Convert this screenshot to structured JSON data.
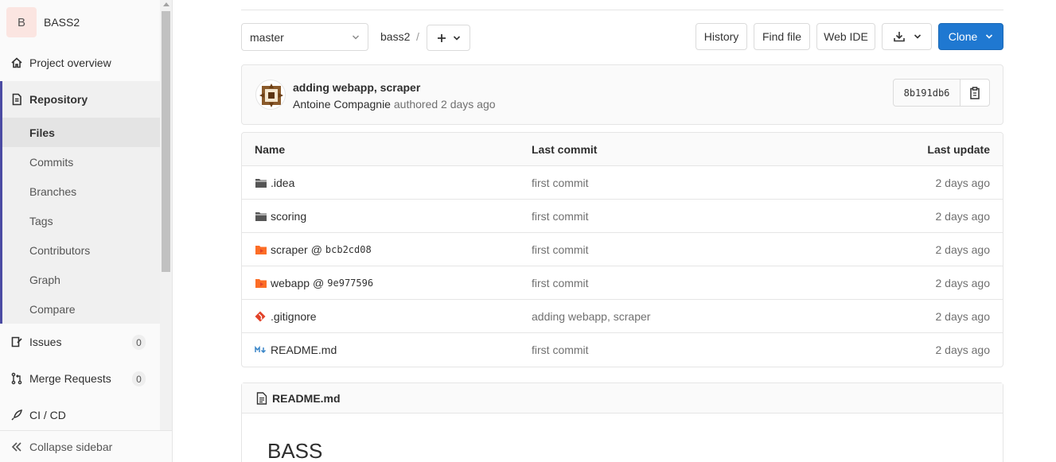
{
  "project": {
    "avatar_letter": "B",
    "name": "BASS2"
  },
  "sidebar": {
    "overview": "Project overview",
    "repository": "Repository",
    "repo_items": [
      "Files",
      "Commits",
      "Branches",
      "Tags",
      "Contributors",
      "Graph",
      "Compare"
    ],
    "issues": {
      "label": "Issues",
      "count": "0"
    },
    "merge_requests": {
      "label": "Merge Requests",
      "count": "0"
    },
    "cicd": "CI / CD",
    "collapse": "Collapse sidebar"
  },
  "toolbar": {
    "branch": "master",
    "breadcrumb": "bass2",
    "separator": "/",
    "history": "History",
    "find_file": "Find file",
    "web_ide": "Web IDE",
    "clone": "Clone"
  },
  "last_commit": {
    "title": "adding webapp, scraper",
    "author": "Antoine Compagnie",
    "authored": "authored",
    "time": "2 days ago",
    "sha": "8b191db6"
  },
  "tree": {
    "headers": {
      "name": "Name",
      "last_commit": "Last commit",
      "last_update": "Last update"
    },
    "rows": [
      {
        "name": ".idea",
        "icon": "folder-icon",
        "commit": "first commit",
        "updated": "2 days ago"
      },
      {
        "name": "scoring",
        "icon": "folder-icon",
        "commit": "first commit",
        "updated": "2 days ago"
      },
      {
        "name": "scraper",
        "icon": "submodule-icon",
        "at": "@",
        "sha": "bcb2cd08",
        "commit": "first commit",
        "updated": "2 days ago"
      },
      {
        "name": "webapp",
        "icon": "submodule-icon",
        "at": "@",
        "sha": "9e977596",
        "commit": "first commit",
        "updated": "2 days ago"
      },
      {
        "name": ".gitignore",
        "icon": "git-icon",
        "commit": "adding webapp, scraper",
        "updated": "2 days ago"
      },
      {
        "name": "README.md",
        "icon": "markdown-icon",
        "commit": "first commit",
        "updated": "2 days ago"
      }
    ]
  },
  "readme": {
    "filename": "README.md",
    "heading": "BASS"
  },
  "colors": {
    "accent": "#1f78d1",
    "nav_active": "#4b4ba3",
    "submodule": "#fc6d26",
    "git": "#e24329"
  }
}
